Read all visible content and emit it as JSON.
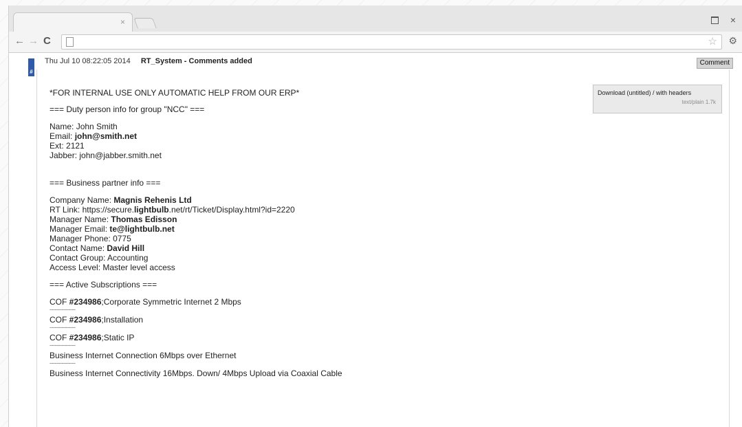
{
  "browser": {
    "tab_close": "×",
    "win_close": "×",
    "nav_back": "←",
    "nav_forward": "→",
    "nav_reload": "C",
    "star": "☆",
    "wrench": "🔧"
  },
  "ticket": {
    "badge": "#",
    "date": "Thu Jul 10 08:22:05 2014",
    "user": "RT_System",
    "action": " - Comments added",
    "comment_button": "Comment",
    "download_title": "Download (untitled) / with headers",
    "download_meta": "text/plain 1.7k"
  },
  "body": {
    "internal_notice": "*FOR INTERNAL USE ONLY AUTOMATIC HELP FROM OUR ERP*",
    "duty_header": "=== Duty person info for group \"NCC\" ===",
    "duty": {
      "name_label": "Name: ",
      "name_value": "John Smith",
      "email_label": "Email: ",
      "email_value": "john@smith.net",
      "ext_label": "Ext: ",
      "ext_value": "2121",
      "jabber_label": "Jabber: ",
      "jabber_value": "john@jabber.smith.net"
    },
    "partner_header": "=== Business partner info ===",
    "partner": {
      "company_label": "Company Name: ",
      "company_value": "Magnis Rehenis Ltd",
      "rtlink_label": "RT Link: https://secure.",
      "rtlink_domain": "lightbulb",
      "rtlink_rest": ".net/rt/Ticket/Display.html?id=2220",
      "manager_label": "Manager Name: ",
      "manager_value": "Thomas Edisson",
      "mgr_email_label": "Manager Email: ",
      "mgr_email_value": "te@lightbulb.net",
      "mgr_phone_label": "Manager Phone: ",
      "mgr_phone_value": "0775",
      "contact_label": "Contact Name: ",
      "contact_value": "David Hill",
      "group_label": "Contact Group: ",
      "group_value": "Accounting",
      "access_label": "Access Level: ",
      "access_value": "Master level access"
    },
    "subs_header": "=== Active Subscriptions ===",
    "separator": "---------------",
    "subscriptions": [
      {
        "prefix": "COF ",
        "id": "#234986",
        "desc": ";Corporate Symmetric Internet 2 Mbps"
      },
      {
        "prefix": "COF ",
        "id": "#234986",
        "desc": ";Installation"
      },
      {
        "prefix": "COF ",
        "id": "#234986",
        "desc": ";Static IP"
      },
      {
        "prefix": "",
        "id": "",
        "desc": "Business Internet Connection 6Mbps over Ethernet"
      },
      {
        "prefix": "",
        "id": "",
        "desc": "Business Internet Connectivity 16Mbps. Down/ 4Mbps Upload via Coaxial Cable"
      }
    ]
  }
}
